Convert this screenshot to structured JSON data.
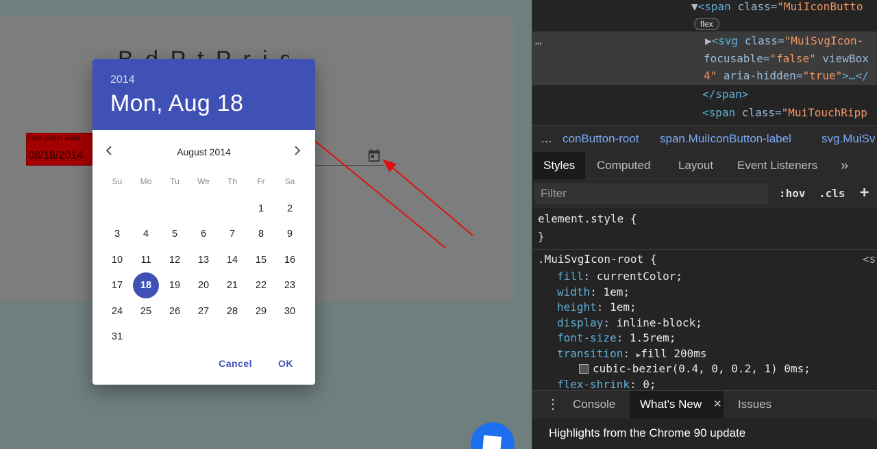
{
  "app": {
    "card_title": "B  d  P  t  P  r  i  d  e",
    "datepicker": {
      "label": "Date picker dialo",
      "value": "08/18/2014"
    }
  },
  "dialog": {
    "year": "2014",
    "selected_date": "Mon, Aug 18",
    "month_label": "August 2014",
    "weekdays": [
      "Su",
      "Mo",
      "Tu",
      "We",
      "Th",
      "Fr",
      "Sa"
    ],
    "leading_blanks": 5,
    "days_in_month": 31,
    "selected_day": 18,
    "cancel_label": "Cancel",
    "ok_label": "OK",
    "accent_color": "#3f51b5"
  },
  "devtools": {
    "elements": {
      "line1_tag": "<span",
      "line1_attr": "class=",
      "line1_val": "\"MuiIconButto",
      "flex_badge": "flex",
      "line2_tag": "<svg",
      "line2_attr": "class=",
      "line2_val": "\"MuiSvgIcon-",
      "line3_attr1": "focusable=",
      "line3_val1": "\"false\"",
      "line3_attr2": "viewBox",
      "line4_val": "4\"",
      "line4_attr": "aria-hidden=",
      "line4_val2": "\"true\"",
      "line4_tag": ">…</",
      "line5_tag": "</span>",
      "line6_tag": "<span",
      "line6_attr": "class=",
      "line6_val": "\"MuiTouchRipp",
      "row_menu": "…"
    },
    "breadcrumbs": [
      "…",
      "conButton-root",
      "span.MuiIconButton-label",
      "svg.MuiSv"
    ],
    "tabs": [
      "Styles",
      "Computed",
      "Layout",
      "Event Listeners",
      "»"
    ],
    "filter": {
      "placeholder": "Filter",
      "hov": ":hov",
      "cls": ".cls",
      "plus": "+"
    },
    "styles": {
      "element_style": "element.style {",
      "close_brace": "}",
      "rule_selector": ".MuiSvgIcon-root {",
      "rule_source": "<st",
      "declarations": [
        {
          "prop": "fill",
          "value": "currentColor;"
        },
        {
          "prop": "width",
          "value": "1em;"
        },
        {
          "prop": "height",
          "value": "1em;"
        },
        {
          "prop": "display",
          "value": "inline-block;"
        },
        {
          "prop": "font-size",
          "value": "1.5rem;"
        },
        {
          "prop": "transition",
          "value": "fill 200ms"
        },
        {
          "prop": "",
          "value": "cubic-bezier(0.4, 0, 0.2, 1) 0ms;"
        },
        {
          "prop": "flex-shrink",
          "value": "0;"
        }
      ]
    },
    "drawer": {
      "menu": "⋮",
      "tabs": [
        "Console",
        "What's New",
        "Issues"
      ],
      "close": "✕",
      "highlight_text": "Highlights from the Chrome 90 update"
    }
  }
}
